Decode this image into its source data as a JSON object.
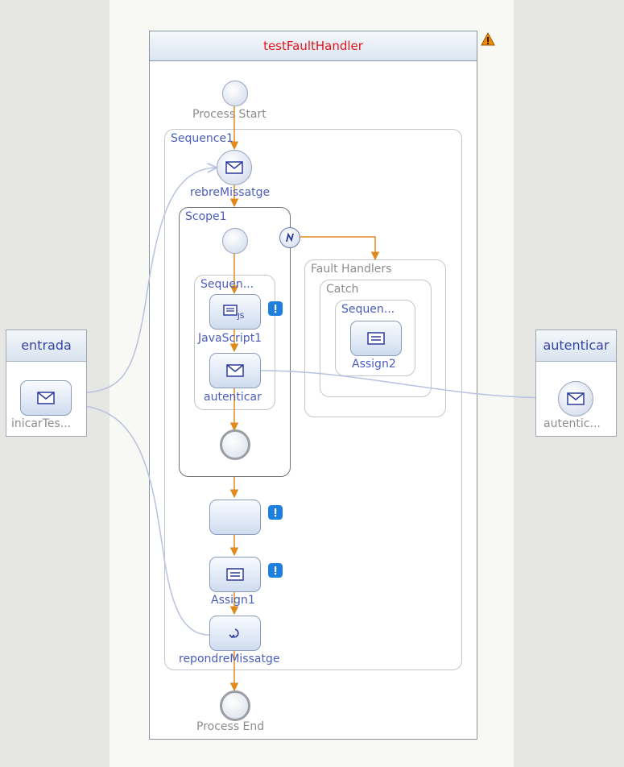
{
  "process": {
    "title": "testFaultHandler"
  },
  "nodes": {
    "process_start": "Process Start",
    "process_end": "Process End",
    "sequence1": "Sequence1",
    "rebre": "rebreMissatge",
    "scope1": "Scope1",
    "sequence_inner": "Sequen...",
    "javascript1": "JavaScript1",
    "js_tag": "JS",
    "autenticar": "autenticar",
    "fault_handlers": "Fault Handlers",
    "catch": "Catch",
    "sequence_catch": "Sequen...",
    "assign2": "Assign2",
    "assign1": "Assign1",
    "repondre": "repondreMissatge"
  },
  "partners": {
    "entrada": {
      "title": "entrada",
      "item": "inicarTes..."
    },
    "autenticar": {
      "title": "autenticar",
      "item": "autentic..."
    }
  },
  "colors": {
    "title": "#e0161a",
    "label": "#4a5dbd",
    "flow": "#e08a1e",
    "message_link": "#b8c2e0",
    "badge": "#1d7fe0",
    "warning": "#f08c00"
  },
  "icons": {
    "message": "envelope-icon",
    "assign": "assign-icon",
    "reply": "reply-icon",
    "fault": "fault-handler-icon",
    "warning": "warning-icon",
    "info": "info-badge-icon"
  }
}
